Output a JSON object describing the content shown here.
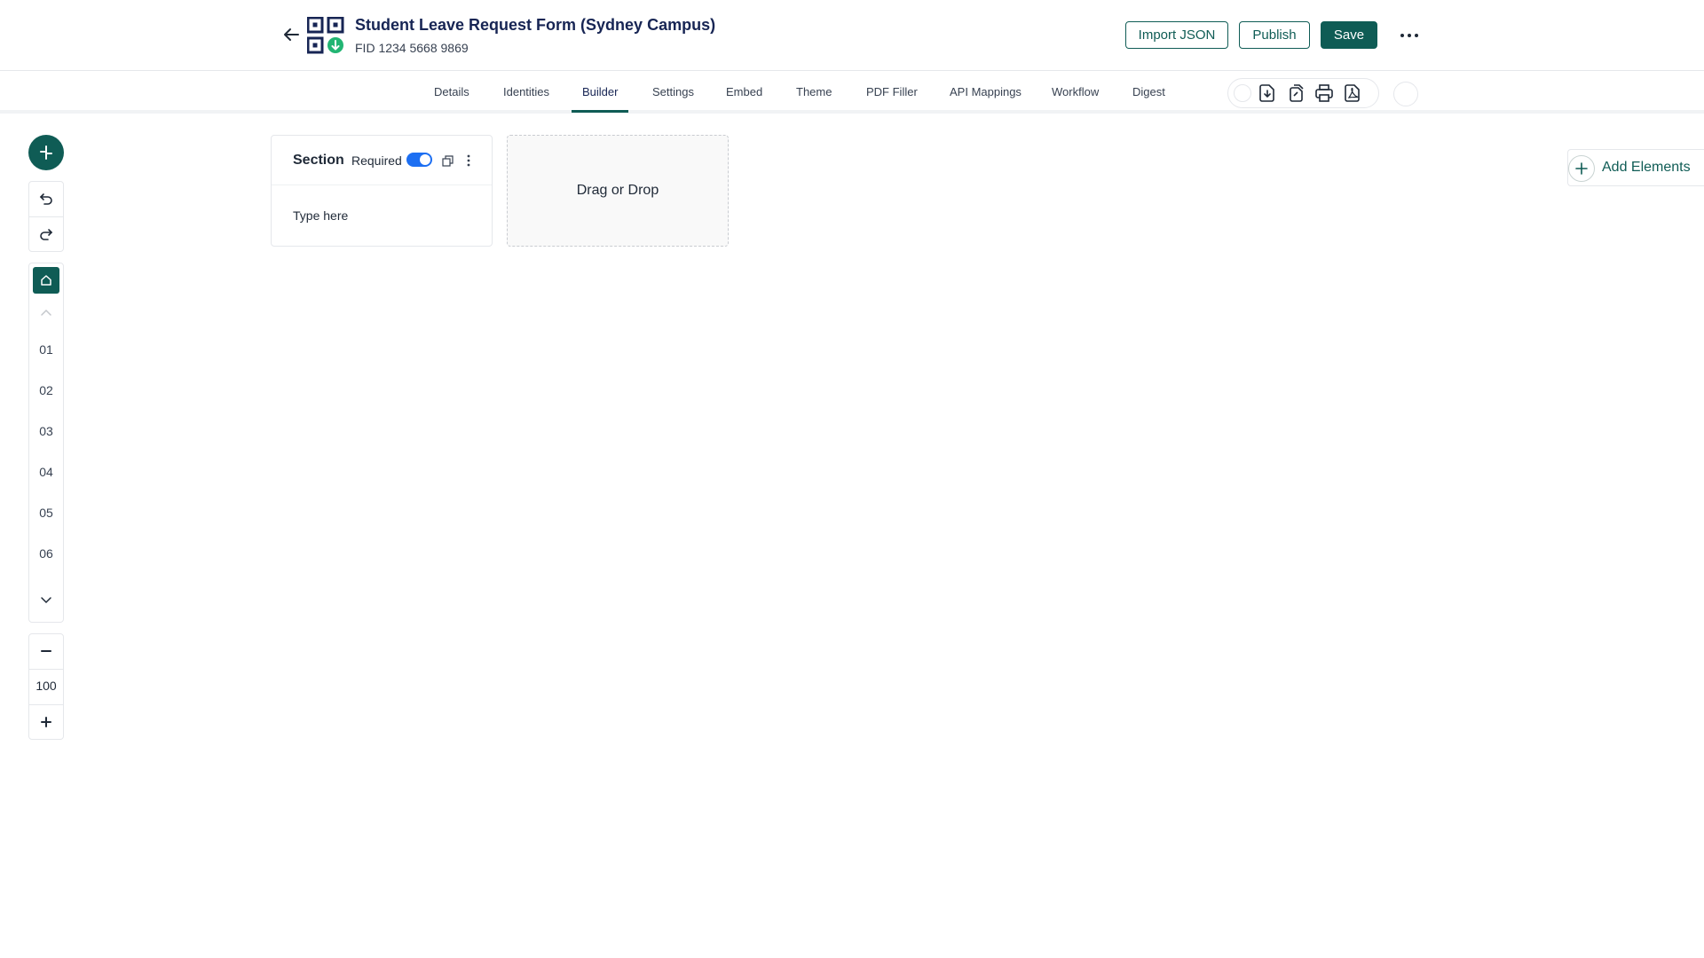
{
  "header": {
    "title": "Student Leave Request Form (Sydney Campus)",
    "subtitle": "FID 1234 5668 9869",
    "import_label": "Import JSON",
    "publish_label": "Publish",
    "save_label": "Save"
  },
  "tabs": [
    {
      "label": "Details"
    },
    {
      "label": "Identities"
    },
    {
      "label": "Builder",
      "active": true
    },
    {
      "label": "Settings"
    },
    {
      "label": "Embed"
    },
    {
      "label": "Theme"
    },
    {
      "label": "PDF Filler"
    },
    {
      "label": "API Mappings"
    },
    {
      "label": "Workflow"
    },
    {
      "label": "Digest"
    }
  ],
  "toolbar_icons": [
    "download-file-icon",
    "copy-file-icon",
    "print-icon",
    "pdf-icon"
  ],
  "rail": {
    "pages": [
      "01",
      "02",
      "03",
      "04",
      "05",
      "06"
    ],
    "zoom": "100"
  },
  "section": {
    "title": "Section",
    "required_label": "Required",
    "required": true,
    "placeholder": "Type here"
  },
  "dropzone": {
    "label": "Drag or Drop"
  },
  "add_elements": {
    "label": "Add Elements"
  },
  "colors": {
    "brand": "#0f5c55",
    "toggle": "#1d6ff2",
    "title": "#172554"
  }
}
